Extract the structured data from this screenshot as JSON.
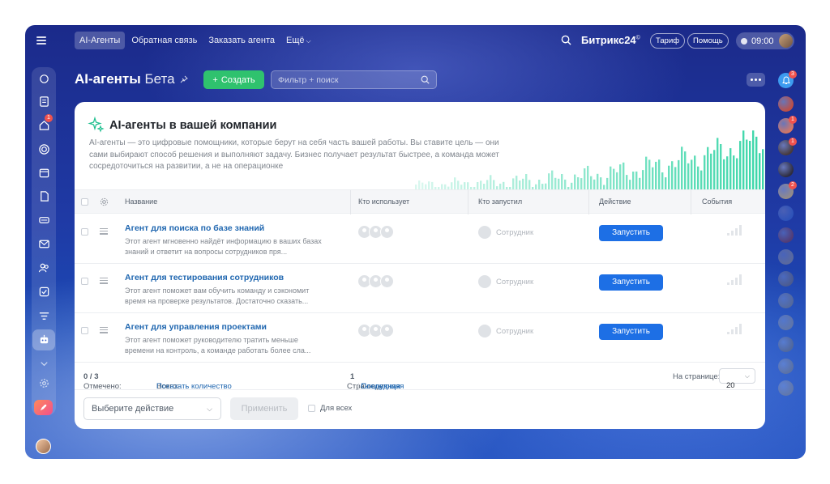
{
  "topbar": {
    "tabs": [
      {
        "label": "AI-Агенты",
        "active": true
      },
      {
        "label": "Обратная связь",
        "active": false
      },
      {
        "label": "Заказать агента",
        "active": false
      },
      {
        "label": "Ещё",
        "active": false
      }
    ],
    "brand": "Битрикс24",
    "brand_mark": "©",
    "tariff_label": "Тариф",
    "help_label": "Помощь",
    "time": "09:00"
  },
  "left_badges": {
    "home": "1"
  },
  "right_badges": {
    "bell": "3",
    "user2": "1",
    "user3": "1",
    "user5": "2"
  },
  "page": {
    "title": "AI-агенты",
    "subtitle": "Бета",
    "create_label": "Создать",
    "filter_placeholder": "Фильтр + поиск"
  },
  "hero": {
    "title": "AI-агенты в вашей компании",
    "description": "AI-агенты — это цифровые помощники, которые берут на себя часть вашей работы. Вы ставите цель — они сами выбирают способ решения и выполняют задачу. Бизнес получает результат быстрее, а команда может сосредоточиться на развитии, а не на операционке"
  },
  "table": {
    "columns": {
      "name": "Название",
      "users": "Кто использует",
      "launcher": "Кто запустил",
      "action": "Действие",
      "events": "События"
    },
    "rows": [
      {
        "name": "Агент для поиска по базе знаний",
        "description": "Этот агент мгновенно найдёт информацию в ваших базах знаний и ответит на вопросы сотрудников пря...",
        "launcher": "Сотрудник",
        "action": "Запустить"
      },
      {
        "name": "Агент для тестирования сотрудников",
        "description": "Этот агент поможет вам обучить команду и сэкономит время на проверке результатов. Достаточно сказать...",
        "launcher": "Сотрудник",
        "action": "Запустить"
      },
      {
        "name": "Агент для управления проектами",
        "description": "Этот агент поможет руководителю тратить меньше времени на контроль, а команде работать более сла...",
        "launcher": "Сотрудник",
        "action": "Запустить"
      }
    ]
  },
  "footer": {
    "selected_label": "Отмечено:",
    "selected_value": "0 / 3",
    "total_label": "Всего:",
    "total_link": "Показать количество",
    "pages_label": "Страницы:",
    "page_current": "1",
    "next_label": "Следующая",
    "last_label": "Последняя",
    "per_page_label": "На странице:",
    "per_page_value": "20"
  },
  "actions_bar": {
    "select_placeholder": "Выберите действие",
    "apply_label": "Применить",
    "for_all_label": "Для всех"
  },
  "colors": {
    "accent_blue": "#1d6fe5",
    "create_green": "#2fc26e",
    "bars_teal": "#2ed3a3",
    "badge_red": "#f0524e"
  }
}
